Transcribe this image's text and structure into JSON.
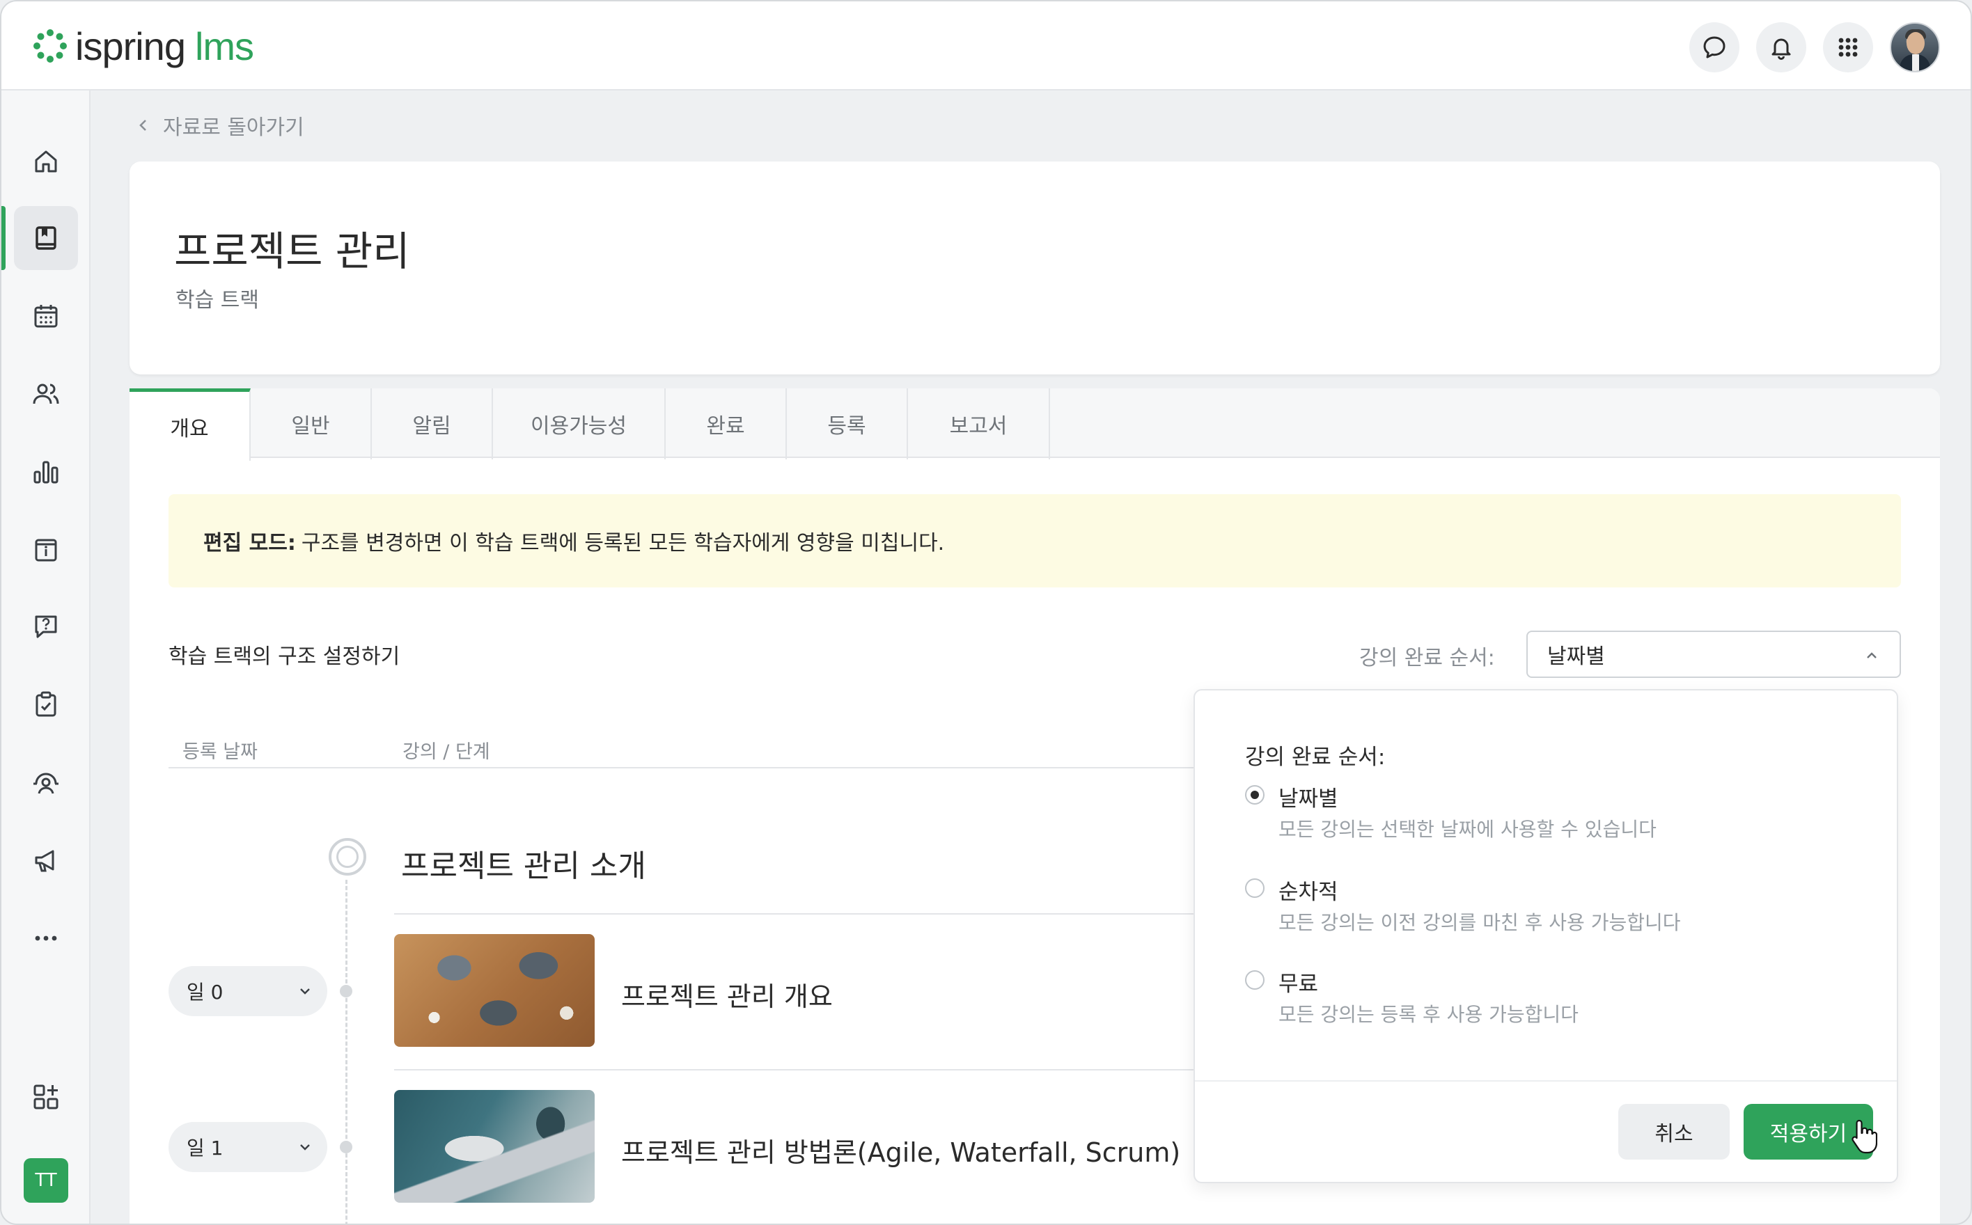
{
  "brand": {
    "name": "ispring",
    "suffix": "lms",
    "accent": "#2fa35b"
  },
  "header": {
    "icons": [
      "chat-icon",
      "bell-icon",
      "apps-grid-icon"
    ],
    "user": "user-avatar"
  },
  "sidebar": {
    "items": [
      "home-icon",
      "courses-icon",
      "calendar-icon",
      "users-icon",
      "reports-icon",
      "info-icon",
      "help-icon",
      "tasks-icon",
      "support-icon",
      "announcements-icon",
      "more-icon",
      "add-widget-icon"
    ],
    "active_index": 1,
    "user_initials": "TT"
  },
  "back_link": "자료로 돌아가기",
  "title": "프로젝트 관리",
  "subtitle": "학습 트랙",
  "tabs": [
    "개요",
    "일반",
    "알림",
    "이용가능성",
    "완료",
    "등록",
    "보고서"
  ],
  "active_tab": 0,
  "notice": {
    "bold": "편집 모드:",
    "text": "구조를 변경하면 이 학습 트랙에 등록된 모든 학습자에게 영향을 미칩니다."
  },
  "structure_label": "학습 트랙의 구조 설정하기",
  "order": {
    "label": "강의 완료 순서:",
    "selected": "날짜별"
  },
  "columns": {
    "date": "등록 날짜",
    "course": "강의 / 단계"
  },
  "stage": {
    "title": "프로젝트 관리 소개"
  },
  "rows": [
    {
      "day": "일 0",
      "title": "프로젝트 관리 개요"
    },
    {
      "day": "일 1",
      "title": "프로젝트 관리 방법론(Agile, Waterfall, Scrum)"
    }
  ],
  "panel": {
    "title": "강의 완료 순서:",
    "options": [
      {
        "label": "날짜별",
        "desc": "모든 강의는 선택한 날짜에 사용할 수 있습니다",
        "checked": true
      },
      {
        "label": "순차적",
        "desc": "모든 강의는 이전 강의를 마친 후 사용 가능합니다",
        "checked": false
      },
      {
        "label": "무료",
        "desc": "모든 강의는 등록 후 사용 가능합니다",
        "checked": false
      }
    ],
    "cancel": "취소",
    "apply": "적용하기"
  }
}
